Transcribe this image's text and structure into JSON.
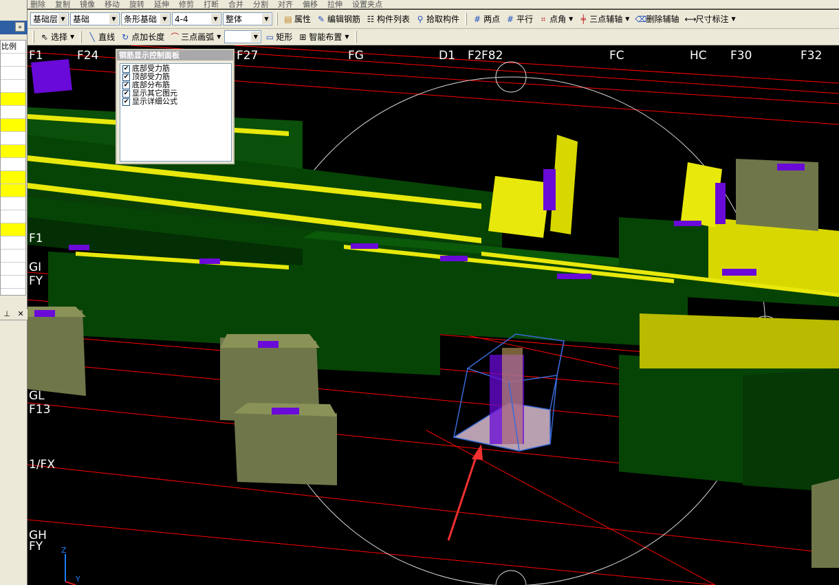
{
  "toolbar0": {
    "items": [
      "删除",
      "复制",
      "镜像",
      "移动",
      "旋转",
      "延伸",
      "修剪",
      "打断",
      "合并",
      "分割",
      "对齐",
      "偏移",
      "拉伸",
      "设置夹点"
    ]
  },
  "toolbar1": {
    "floor": "基础层",
    "category": "基础",
    "type": "条形基础",
    "name": "4-4",
    "scope": "整体",
    "buttons": {
      "properties": "属性",
      "edit_rebar": "编辑钢筋",
      "component_list": "构件列表",
      "pick_component": "拾取构件",
      "two_points": "两点",
      "parallel": "平行",
      "point_angle": "点角",
      "three_point_axis": "三点辅轴",
      "delete_axis": "删除辅轴",
      "dimension": "尺寸标注"
    }
  },
  "toolbar2": {
    "select": "选择",
    "line": "直线",
    "point_length": "点加长度",
    "three_point_arc": "三点画弧",
    "arc_value": "",
    "rect": "矩形",
    "smart_layout": "智能布置"
  },
  "left_panel": {
    "header_label": "比例",
    "rows": [
      false,
      false,
      false,
      true,
      false,
      true,
      false,
      true,
      false,
      true,
      true,
      false,
      false,
      true,
      false,
      false,
      false,
      false,
      false
    ],
    "pin_icon": "pin-icon",
    "close_icon": "close-icon"
  },
  "rebar_panel": {
    "title": "钢筋显示控制面板",
    "options": [
      {
        "label": "底部受力筋",
        "checked": true
      },
      {
        "label": "顶部受力筋",
        "checked": true
      },
      {
        "label": "底部分布筋",
        "checked": true
      },
      {
        "label": "显示其它图元",
        "checked": true
      },
      {
        "label": "显示详细公式",
        "checked": true
      }
    ]
  },
  "axis_labels": {
    "top": [
      "F1",
      "F24",
      "F27",
      "FG",
      "D1",
      "F2",
      "F82",
      "FC",
      "HC",
      "F30",
      "F32"
    ],
    "left": [
      "F1",
      "GI",
      "FY",
      "GL",
      "F13",
      "1/FX",
      "GH",
      "FY"
    ]
  },
  "colors": {
    "foundation_green": "#064406",
    "rebar_yellow": "#e8e80c",
    "rebar_purple": "#6a0ad8",
    "pad_olive": "#6f774a",
    "grid_red": "#ff0000",
    "selection_blue": "#3a6ad8",
    "arrow_red": "#f03030"
  }
}
